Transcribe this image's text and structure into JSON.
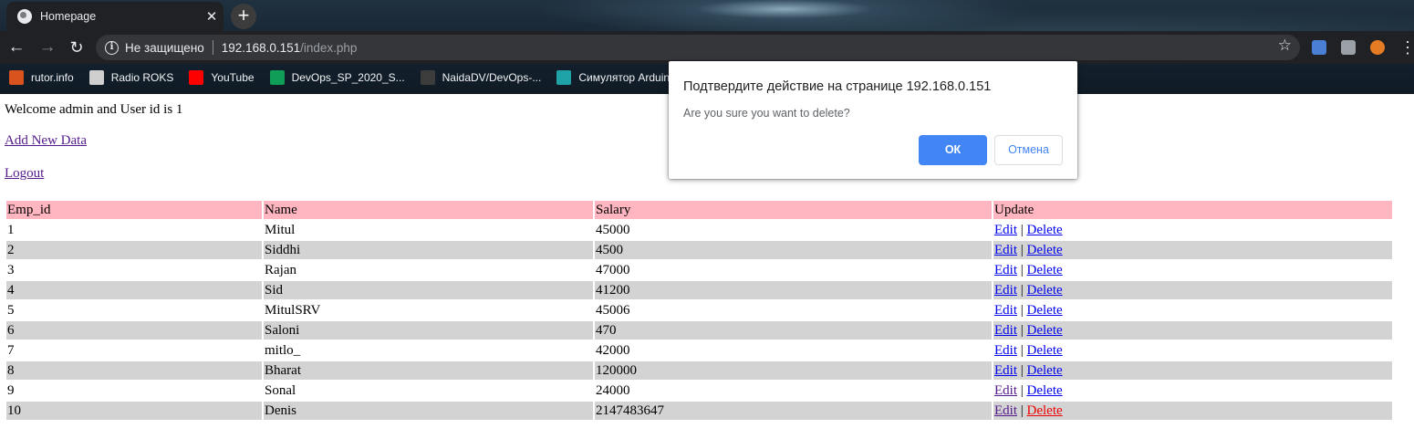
{
  "browser": {
    "tab": {
      "title": "Homepage",
      "close_glyph": "✕"
    },
    "new_tab_glyph": "+",
    "nav": {
      "back_glyph": "←",
      "forward_glyph": "→",
      "reload_glyph": "↻"
    },
    "address": {
      "security_label": "Не защищено",
      "host": "192.168.0.151",
      "path": "/index.php"
    },
    "star_glyph": "☆",
    "menu_glyph": "⋮",
    "bookmarks": [
      {
        "label": "rutor.info",
        "icon": "rutor-icon",
        "color": "#d9531e"
      },
      {
        "label": "Radio ROKS",
        "icon": "radio-roks-icon",
        "color": "#cfcfcf"
      },
      {
        "label": "YouTube",
        "icon": "youtube-icon",
        "color": "#ff0000"
      },
      {
        "label": "DevOps_SP_2020_S...",
        "icon": "sheets-icon",
        "color": "#0f9d58"
      },
      {
        "label": "NaidaDV/DevOps-...",
        "icon": "github-icon",
        "color": "#3c3c3c"
      },
      {
        "label": "Симулятор Arduin...",
        "icon": "arduino-icon",
        "color": "#1fa3a6"
      }
    ]
  },
  "page": {
    "welcome_text": "Welcome admin and User id is 1",
    "add_new_label": "Add New Data",
    "logout_label": "Logout",
    "table": {
      "headers": [
        "Emp_id",
        "Name",
        "Salary",
        "Update"
      ],
      "rows": [
        {
          "id": "1",
          "name": "Mitul",
          "salary": "45000"
        },
        {
          "id": "2",
          "name": "Siddhi",
          "salary": "4500"
        },
        {
          "id": "3",
          "name": "Rajan",
          "salary": "47000"
        },
        {
          "id": "4",
          "name": "Sid",
          "salary": "41200"
        },
        {
          "id": "5",
          "name": "MitulSRV",
          "salary": "45006"
        },
        {
          "id": "6",
          "name": "Saloni",
          "salary": "470"
        },
        {
          "id": "7",
          "name": "mitlo_",
          "salary": "42000"
        },
        {
          "id": "8",
          "name": "Bharat",
          "salary": "120000"
        },
        {
          "id": "9",
          "name": "Sonal",
          "salary": "24000"
        },
        {
          "id": "10",
          "name": "Denis",
          "salary": "2147483647"
        }
      ],
      "edit_label": "Edit",
      "separator": "|",
      "delete_label": "Delete"
    }
  },
  "dialog": {
    "title": "Подтвердите действие на странице 192.168.0.151",
    "message": "Are you sure you want to delete?",
    "ok_label": "ОК",
    "cancel_label": "Отмена"
  },
  "colors": {
    "header_row": "#ffb6c1",
    "stripe_row": "#d3d3d3",
    "link": "#0000ee",
    "visited_link": "#551a8b",
    "active_link": "#ee0000",
    "dialog_ok": "#4285f4"
  }
}
